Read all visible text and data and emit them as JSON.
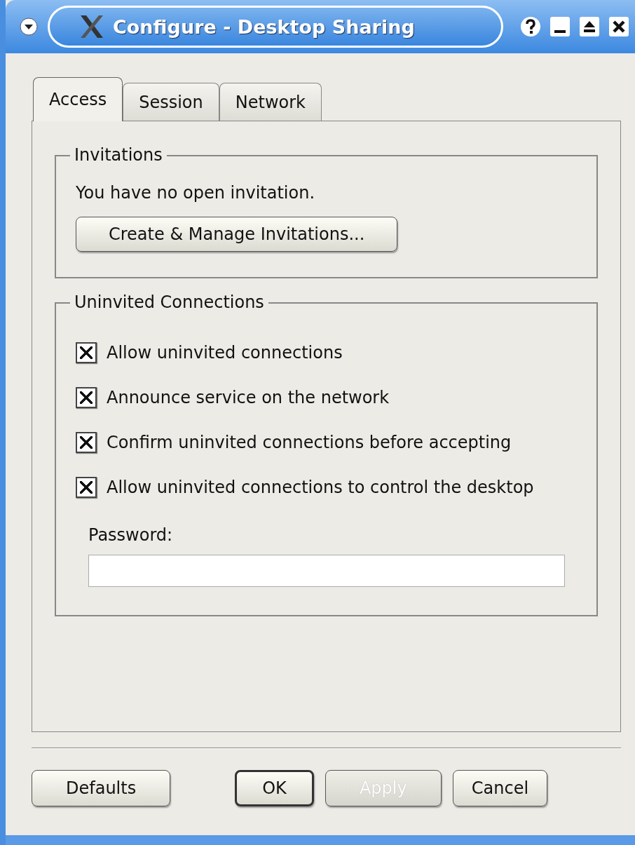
{
  "window": {
    "title": "Configure - Desktop Sharing"
  },
  "tabs": [
    {
      "label": "Access",
      "selected": true
    },
    {
      "label": "Session",
      "selected": false
    },
    {
      "label": "Network",
      "selected": false
    }
  ],
  "invitations": {
    "title": "Invitations",
    "status": "You have no open invitation.",
    "button": "Create & Manage Invitations..."
  },
  "uninvited": {
    "title": "Uninvited Connections",
    "options": [
      {
        "label": "Allow uninvited connections",
        "checked": true
      },
      {
        "label": "Announce service on the network",
        "checked": true
      },
      {
        "label": "Confirm uninvited connections before accepting",
        "checked": true
      },
      {
        "label": "Allow uninvited connections to control the desktop",
        "checked": true
      }
    ],
    "password_label": "Password:"
  },
  "buttons": [
    {
      "label": "Defaults",
      "default": false,
      "disabled": false
    },
    {
      "label": "OK",
      "default": true,
      "disabled": false
    },
    {
      "label": "Apply",
      "default": false,
      "disabled": true
    },
    {
      "label": "Cancel",
      "default": false,
      "disabled": false
    }
  ]
}
